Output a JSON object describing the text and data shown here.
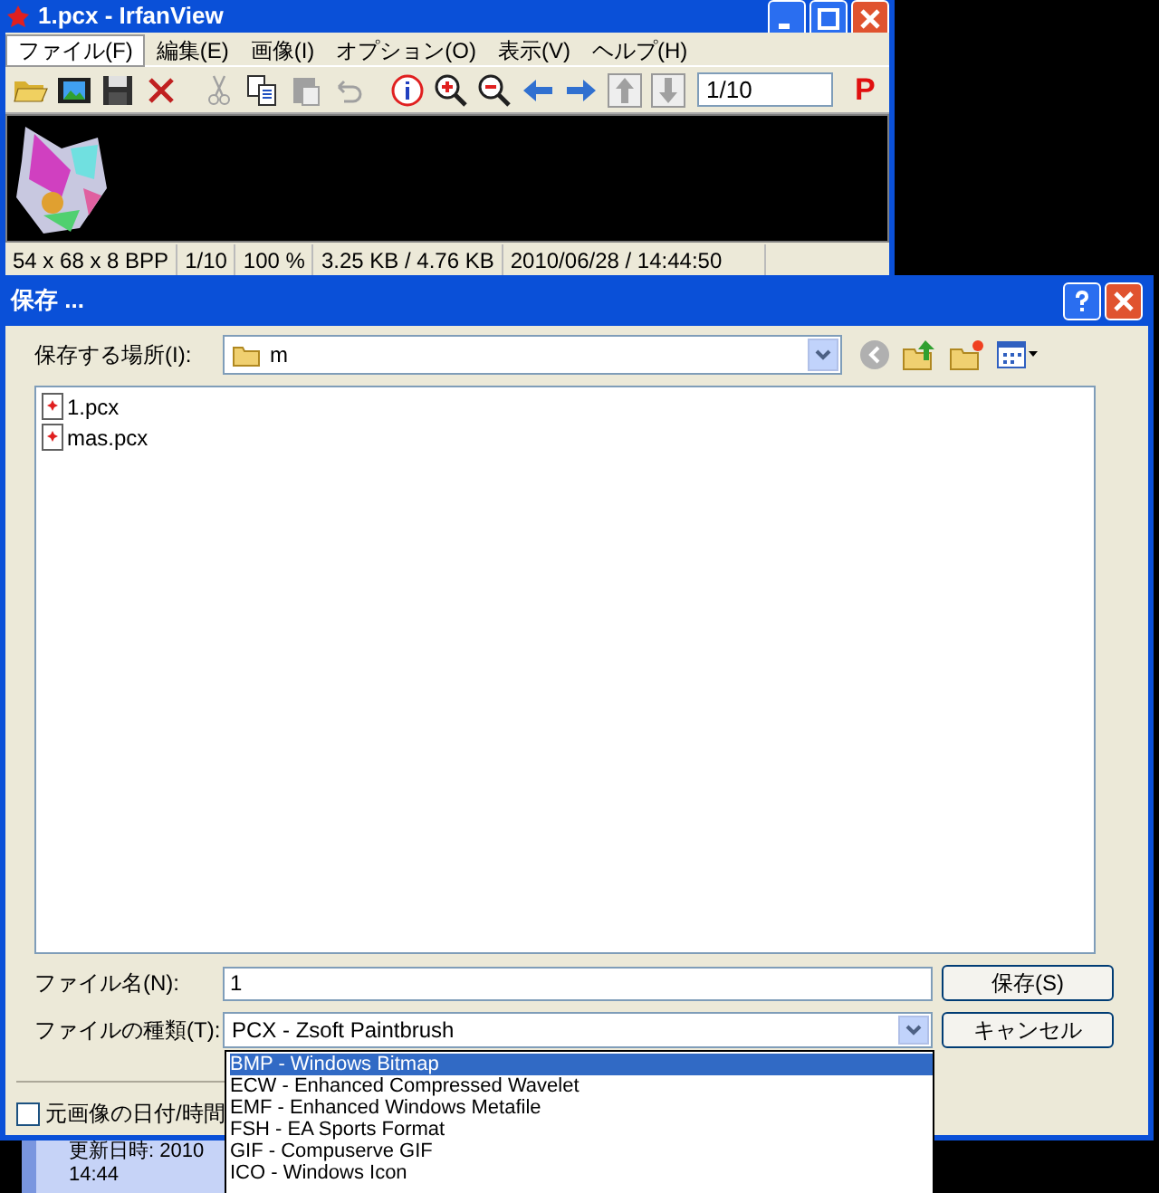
{
  "viewer": {
    "title": "1.pcx - IrfanView",
    "menu": [
      {
        "label": "ファイル(F)",
        "selected": true
      },
      {
        "label": "編集(E)",
        "selected": false
      },
      {
        "label": "画像(I)",
        "selected": false
      },
      {
        "label": "オプション(O)",
        "selected": false
      },
      {
        "label": "表示(V)",
        "selected": false
      },
      {
        "label": "ヘルプ(H)",
        "selected": false
      }
    ],
    "toolbar": [
      {
        "kind": "open",
        "disabled": false
      },
      {
        "kind": "slideshow",
        "disabled": false
      },
      {
        "kind": "save",
        "disabled": false
      },
      {
        "kind": "delete",
        "disabled": false
      },
      {
        "kind": "sep"
      },
      {
        "kind": "cut",
        "disabled": true
      },
      {
        "kind": "copy",
        "disabled": false
      },
      {
        "kind": "paste",
        "disabled": true
      },
      {
        "kind": "undo",
        "disabled": true
      },
      {
        "kind": "sep"
      },
      {
        "kind": "info",
        "disabled": false
      },
      {
        "kind": "zoomin",
        "disabled": false
      },
      {
        "kind": "zoomout",
        "disabled": false
      },
      {
        "kind": "prev",
        "disabled": false
      },
      {
        "kind": "next",
        "disabled": false
      },
      {
        "kind": "first",
        "disabled": true
      },
      {
        "kind": "last",
        "disabled": true
      }
    ],
    "page_field": "1/10",
    "p_button": "P",
    "image": {
      "kind": "picture"
    },
    "status_bar": [
      "54 x 68 x 8 BPP",
      "1/10",
      "100 %",
      "3.25 KB / 4.76 KB",
      "2010/06/28 / 14:44:50"
    ]
  },
  "dialog": {
    "title": "保存 ...",
    "location_label": "保存する場所(I):",
    "location": "m",
    "files": [
      "1.pcx",
      "mas.pcx"
    ],
    "filename_label": "ファイル名(N):",
    "filename": "1",
    "type_label": "ファイルの種類(T):",
    "type": "PCX - Zsoft Paintbrush",
    "save_button": "保存(S)",
    "cancel_button": "キャンセル",
    "keep_date": {
      "label": "元画像の日付/時間",
      "checked": false
    },
    "type_options": [
      {
        "label": "BMP - Windows Bitmap",
        "selected": true
      },
      {
        "label": "ECW - Enhanced Compressed Wavelet",
        "selected": false
      },
      {
        "label": "EMF - Enhanced Windows Metafile",
        "selected": false
      },
      {
        "label": "FSH - EA Sports Format",
        "selected": false
      },
      {
        "label": "GIF - Compuserve GIF",
        "selected": false
      },
      {
        "label": "ICO - Windows Icon",
        "selected": false
      }
    ]
  },
  "info_panel": [
    "更新日時: 2010",
    "14:44"
  ]
}
